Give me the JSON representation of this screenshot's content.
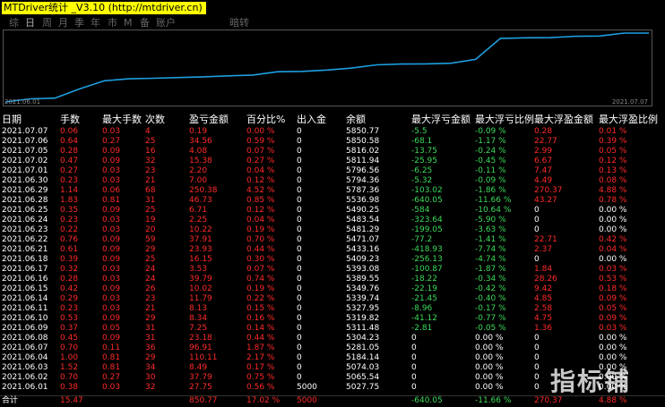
{
  "title": "MTDriver统计 _V3.10 (http://mtdriver.cn)",
  "tabs": [
    "综",
    "日",
    "周",
    "月",
    "季",
    "年",
    "市",
    "M",
    "备",
    "账户",
    "暗转"
  ],
  "active_tab": 1,
  "chart": {
    "start_label": "2021.06.01",
    "end_label": "2021.07.07",
    "balance_series": [
      5027.75,
      5065.54,
      5074.03,
      5184.14,
      5281.05,
      5304.23,
      5311.48,
      5319.82,
      5327.95,
      5339.74,
      5349.76,
      5389.55,
      5393.08,
      5409.23,
      5433.16,
      5471.07,
      5481.29,
      5483.54,
      5490.25,
      5536.98,
      5787.36,
      5794.36,
      5796.56,
      5811.94,
      5816.02,
      5850.58,
      5850.77
    ]
  },
  "columns": [
    "日期",
    "手数",
    "最大手数",
    "次数",
    "盈亏金额",
    "百分比%",
    "出入金",
    "余额",
    "最大浮亏金额",
    "最大浮亏比例",
    "最大浮盈金额",
    "最大浮盈比例"
  ],
  "rows": [
    [
      "2021.07.07",
      "0.06",
      "0.03",
      "4",
      "0.19",
      "0.00 %",
      "0",
      "5850.77",
      "-5.5",
      "-0.09 %",
      "0.28",
      "0.01 %"
    ],
    [
      "2021.07.06",
      "0.64",
      "0.27",
      "25",
      "34.56",
      "0.59 %",
      "0",
      "5850.58",
      "-68.1",
      "-1.17 %",
      "22.77",
      "0.39 %"
    ],
    [
      "2021.07.05",
      "0.28",
      "0.09",
      "16",
      "4.08",
      "0.07 %",
      "0",
      "5816.02",
      "-13.75",
      "-0.24 %",
      "2.99",
      "0.05 %"
    ],
    [
      "2021.07.02",
      "0.47",
      "0.09",
      "32",
      "15.38",
      "0.27 %",
      "0",
      "5811.94",
      "-25.95",
      "-0.45 %",
      "6.67",
      "0.12 %"
    ],
    [
      "2021.07.01",
      "0.27",
      "0.03",
      "23",
      "2.20",
      "0.04 %",
      "0",
      "5796.56",
      "-6.25",
      "-0.11 %",
      "7.47",
      "0.13 %"
    ],
    [
      "2021.06.30",
      "0.23",
      "0.03",
      "21",
      "7.00",
      "0.12 %",
      "0",
      "5794.36",
      "-5.32",
      "-0.09 %",
      "4.49",
      "0.08 %"
    ],
    [
      "2021.06.29",
      "1.14",
      "0.06",
      "68",
      "250.38",
      "4.52 %",
      "0",
      "5787.36",
      "-103.02",
      "-1.86 %",
      "270.37",
      "4.88 %"
    ],
    [
      "2021.06.28",
      "1.83",
      "0.81",
      "31",
      "46.73",
      "0.85 %",
      "0",
      "5536.98",
      "-640.05",
      "-11.66 %",
      "43.27",
      "0.78 %"
    ],
    [
      "2021.06.25",
      "0.35",
      "0.09",
      "25",
      "6.71",
      "0.12 %",
      "0",
      "5490.25",
      "-584",
      "-10.64 %",
      "0",
      "0.00 %"
    ],
    [
      "2021.06.24",
      "0.23",
      "0.03",
      "19",
      "2.25",
      "0.04 %",
      "0",
      "5483.54",
      "-323.64",
      "-5.90 %",
      "0",
      "0.00 %"
    ],
    [
      "2021.06.23",
      "0.22",
      "0.03",
      "20",
      "10.22",
      "0.19 %",
      "0",
      "5481.29",
      "-199.05",
      "-3.63 %",
      "0",
      "0.00 %"
    ],
    [
      "2021.06.22",
      "0.76",
      "0.09",
      "59",
      "37.91",
      "0.70 %",
      "0",
      "5471.07",
      "-77.2",
      "-1.41 %",
      "22.71",
      "0.42 %"
    ],
    [
      "2021.06.21",
      "0.61",
      "0.09",
      "29",
      "23.93",
      "0.44 %",
      "0",
      "5433.16",
      "-418.93",
      "-7.74 %",
      "2.37",
      "0.04 %"
    ],
    [
      "2021.06.18",
      "0.39",
      "0.09",
      "25",
      "16.15",
      "0.30 %",
      "0",
      "5409.23",
      "-256.13",
      "-4.74 %",
      "0",
      "0.00 %"
    ],
    [
      "2021.06.17",
      "0.32",
      "0.03",
      "24",
      "3.53",
      "0.07 %",
      "0",
      "5393.08",
      "-100.87",
      "-1.87 %",
      "1.84",
      "0.03 %"
    ],
    [
      "2021.06.16",
      "0.28",
      "0.03",
      "24",
      "39.79",
      "0.74 %",
      "0",
      "5389.55",
      "-18.22",
      "-0.34 %",
      "28.26",
      "0.53 %"
    ],
    [
      "2021.06.15",
      "0.42",
      "0.09",
      "26",
      "10.02",
      "0.19 %",
      "0",
      "5349.76",
      "-22.19",
      "-0.42 %",
      "9.42",
      "0.18 %"
    ],
    [
      "2021.06.14",
      "0.29",
      "0.03",
      "23",
      "11.79",
      "0.22 %",
      "0",
      "5339.74",
      "-21.45",
      "-0.40 %",
      "4.85",
      "0.09 %"
    ],
    [
      "2021.06.11",
      "0.23",
      "0.03",
      "21",
      "8.13",
      "0.15 %",
      "0",
      "5327.95",
      "-8.96",
      "-0.17 %",
      "2.58",
      "0.05 %"
    ],
    [
      "2021.06.10",
      "0.53",
      "0.09",
      "29",
      "8.34",
      "0.16 %",
      "0",
      "5319.82",
      "-41.12",
      "-0.77 %",
      "4.75",
      "0.09 %"
    ],
    [
      "2021.06.09",
      "0.37",
      "0.05",
      "31",
      "7.25",
      "0.14 %",
      "0",
      "5311.48",
      "-2.81",
      "-0.05 %",
      "1.36",
      "0.03 %"
    ],
    [
      "2021.06.08",
      "0.45",
      "0.09",
      "31",
      "23.18",
      "0.44 %",
      "0",
      "5304.23",
      "0",
      "0.00 %",
      "0",
      "0.00 %"
    ],
    [
      "2021.06.07",
      "0.70",
      "0.11",
      "36",
      "96.91",
      "1.87 %",
      "0",
      "5281.05",
      "0",
      "0.00 %",
      "0",
      "0.00 %"
    ],
    [
      "2021.06.04",
      "1.00",
      "0.81",
      "29",
      "110.11",
      "2.17 %",
      "0",
      "5184.14",
      "0",
      "0.00 %",
      "0",
      "0.00 %"
    ],
    [
      "2021.06.03",
      "1.52",
      "0.81",
      "34",
      "8.49",
      "0.17 %",
      "0",
      "5074.03",
      "0",
      "0.00 %",
      "0",
      "0.00 %"
    ],
    [
      "2021.06.02",
      "0.70",
      "0.27",
      "30",
      "37.79",
      "0.75 %",
      "0",
      "5065.54",
      "0",
      "0.00 %",
      "0",
      "0.00 %"
    ],
    [
      "2021.06.01",
      "0.38",
      "0.03",
      "32",
      "27.75",
      "0.56 %",
      "5000",
      "5027.75",
      "0",
      "0.00 %",
      "0",
      "0.00 %"
    ]
  ],
  "total": [
    "合计",
    "15.47",
    "",
    "",
    "850.77",
    "17.02 %",
    "5000",
    "",
    "-640.05",
    "-11.66 %",
    "270.37",
    "4.88 %"
  ],
  "watermark": "指标铺",
  "colors": {
    "positive": "#ff2a2a",
    "negative": "#3cd95a",
    "neutral": "#ffffff",
    "line": "#1e9fe0",
    "title_bg": "#ffff00"
  }
}
